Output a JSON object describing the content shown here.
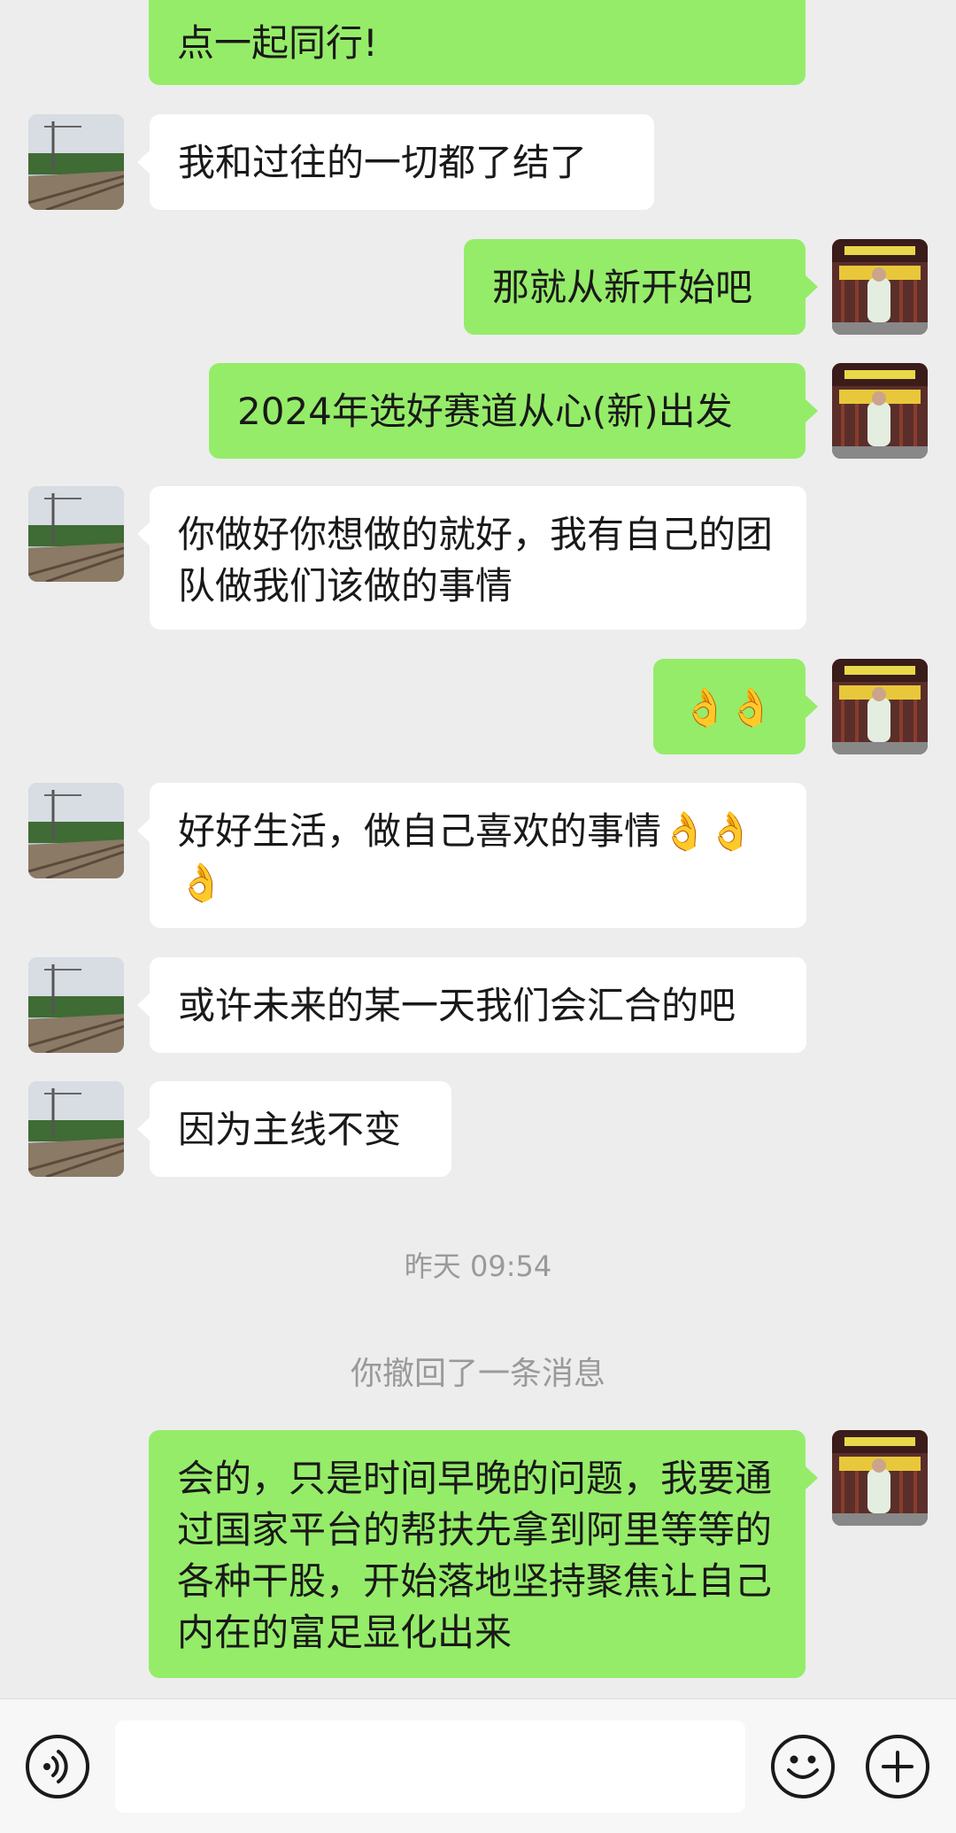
{
  "messages": [
    {
      "side": "out",
      "text": "点一起同行!"
    },
    {
      "side": "in",
      "text": "我和过往的一切都了结了"
    },
    {
      "side": "out",
      "text": "那就从新开始吧"
    },
    {
      "side": "out",
      "text": "2024年选好赛道从心(新)出发"
    },
    {
      "side": "in",
      "text": "你做好你想做的就好，我有自己的团队做我们该做的事情"
    },
    {
      "side": "out",
      "text": "👌👌"
    },
    {
      "side": "in",
      "text": "好好生活，做自己喜欢的事情👌👌👌"
    },
    {
      "side": "in",
      "text": "或许未来的某一天我们会汇合的吧"
    },
    {
      "side": "in",
      "text": "因为主线不变"
    },
    {
      "side": "out",
      "text": "会的，只是时间早晚的问题，我要通过国家平台的帮扶先拿到阿里等等的各种干股，开始落地坚持聚焦让自己内在的富足显化出来"
    }
  ],
  "timestamp": "昨天 09:54",
  "recall_notice": "你撤回了一条消息",
  "input": {
    "placeholder": "",
    "value": ""
  },
  "icons": {
    "voice": "voice-icon",
    "emoji": "emoji-icon",
    "more": "plus-icon",
    "contact_avatar": "railway-avatar",
    "my_avatar": "gate-avatar"
  },
  "colors": {
    "background": "#ededed",
    "outgoing_bubble": "#95ec69",
    "incoming_bubble": "#ffffff",
    "system_text": "#9a9a9a"
  }
}
